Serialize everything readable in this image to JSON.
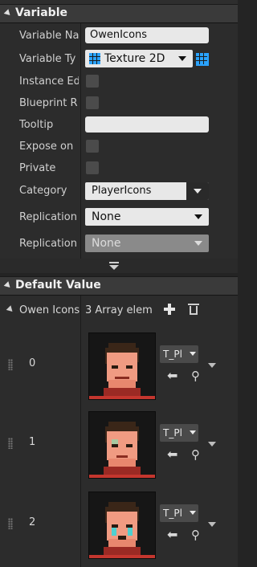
{
  "variable_section": {
    "title": "Variable",
    "fields": [
      {
        "label": "Variable Na",
        "value": "OwenIcons"
      },
      {
        "label": "Variable Ty",
        "value": "Texture 2D"
      },
      {
        "label": "Instance Ed"
      },
      {
        "label": "Blueprint R"
      },
      {
        "label": "Tooltip",
        "value": ""
      },
      {
        "label": "Expose on"
      },
      {
        "label": "Private"
      },
      {
        "label": "Category",
        "value": "PlayerIcons"
      },
      {
        "label": "Replication",
        "value": "None"
      },
      {
        "label": "Replication",
        "value": "None"
      }
    ]
  },
  "default_section": {
    "title": "Default Value",
    "array_label": "Owen Icons",
    "array_summary": "3 Array elem",
    "elements": [
      {
        "index": "0",
        "asset": "T_Pl"
      },
      {
        "index": "1",
        "asset": "T_Pl"
      },
      {
        "index": "2",
        "asset": "T_Pl"
      }
    ]
  },
  "colors": {
    "accent": "#2aa3ff",
    "panel": "#242424",
    "header": "#3a3a3a",
    "asset_bar": "#c4362e"
  }
}
